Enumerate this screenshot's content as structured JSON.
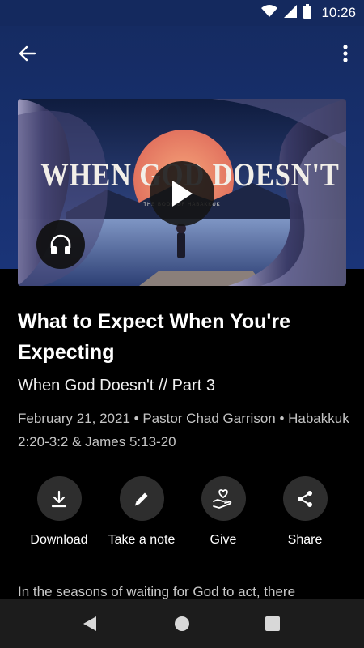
{
  "status_bar": {
    "time": "10:26",
    "icons": [
      "wifi-icon",
      "cell-signal-icon",
      "battery-icon"
    ]
  },
  "app_bar": {
    "back_icon": "arrow-back-icon",
    "menu_icon": "more-vert-icon"
  },
  "artwork": {
    "title_text": "WHEN GOD DOESN'T",
    "subtitle_text": "THE BOOK OF HABAKKUK",
    "play_icon": "play-icon",
    "audio_icon": "headphones-icon"
  },
  "sermon": {
    "title": "What to Expect When You're Expecting",
    "series": "When God Doesn't // Part 3",
    "meta": "February 21, 2021 • Pastor Chad Garrison • Habakkuk 2:20-3:2 & James 5:13-20",
    "description": "In the seasons of waiting for God to act, there"
  },
  "actions": [
    {
      "label": "Download",
      "icon": "download-icon"
    },
    {
      "label": "Take a note",
      "icon": "pencil-icon"
    },
    {
      "label": "Give",
      "icon": "give-heart-hand-icon"
    },
    {
      "label": "Share",
      "icon": "share-icon"
    }
  ],
  "nav_bar": {
    "icons": [
      "nav-back-icon",
      "nav-home-icon",
      "nav-recents-icon"
    ]
  },
  "colors": {
    "header_bg": "#152b62",
    "page_bg": "#000000",
    "action_circle": "#2e2e2e",
    "meta_text": "#c4c4c4",
    "nav_bg": "#1c1c1c"
  }
}
